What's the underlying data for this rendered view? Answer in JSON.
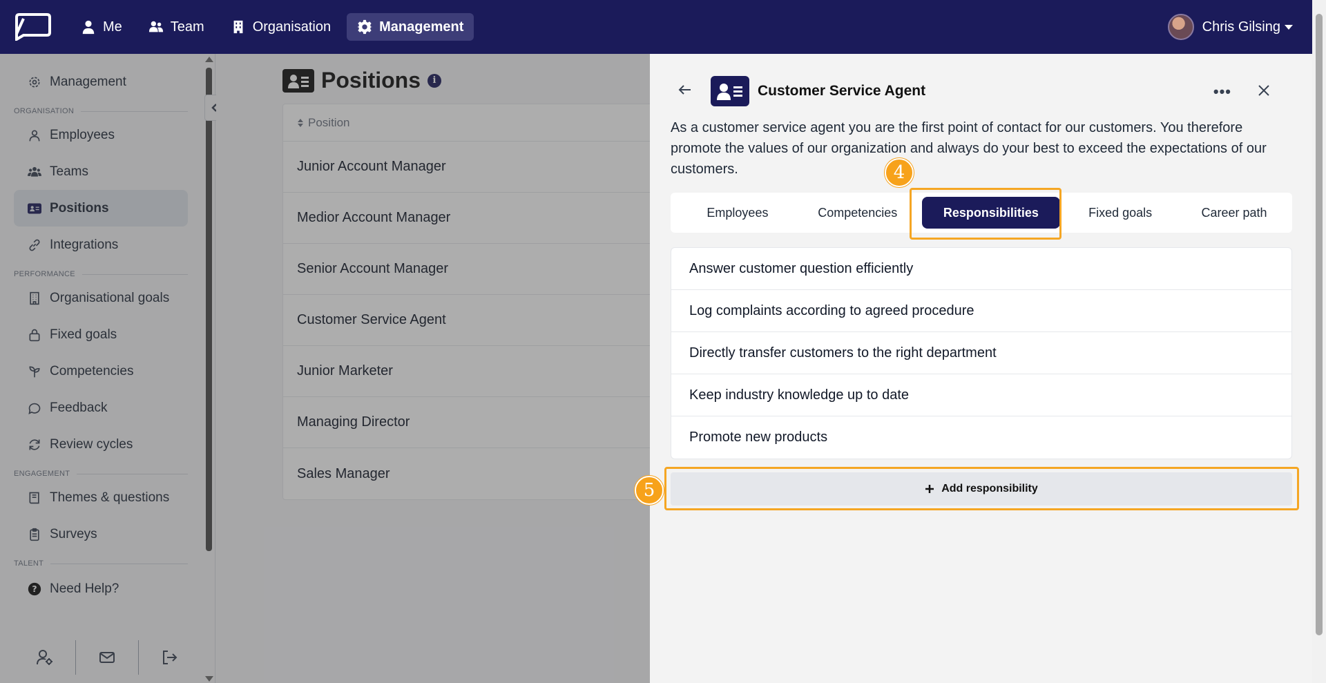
{
  "nav": {
    "items": [
      {
        "label": "Me",
        "icon": "user-icon"
      },
      {
        "label": "Team",
        "icon": "users-icon"
      },
      {
        "label": "Organisation",
        "icon": "building-icon"
      },
      {
        "label": "Management",
        "icon": "gear-icon"
      }
    ],
    "active": "Management",
    "user_name": "Chris Gilsing"
  },
  "sidebar": {
    "top_item": "Management",
    "sections": {
      "organisation": "ORGANISATION",
      "performance": "PERFORMANCE",
      "engagement": "ENGAGEMENT",
      "talent": "TALENT"
    },
    "organisation_items": [
      "Employees",
      "Teams",
      "Positions",
      "Integrations"
    ],
    "performance_items": [
      "Organisational goals",
      "Fixed goals",
      "Competencies",
      "Feedback",
      "Review cycles"
    ],
    "engagement_items": [
      "Themes & questions",
      "Surveys"
    ],
    "help": "Need Help?",
    "active": "Positions"
  },
  "main": {
    "title": "Positions",
    "info_glyph": "i",
    "column_header": "Position",
    "rows": [
      "Junior Account Manager",
      "Medior Account Manager",
      "Senior Account Manager",
      "Customer Service Agent",
      "Junior Marketer",
      "Managing Director",
      "Sales Manager"
    ]
  },
  "drawer": {
    "title": "Customer Service Agent",
    "description": "As a customer service agent you are the first point of contact for our customers. You therefore promote the values of our organization and always do your best to exceed the expectations of our customers.",
    "tabs": [
      "Employees",
      "Competencies",
      "Responsibilities",
      "Fixed goals",
      "Career path"
    ],
    "active_tab": "Responsibilities",
    "responsibilities": [
      "Answer customer question efficiently",
      "Log complaints according to agreed procedure",
      "Directly transfer customers to the right department",
      "Keep industry knowledge up to date",
      "Promote new products"
    ],
    "add_label": "Add responsibility"
  },
  "steps": {
    "four": "4",
    "five": "5"
  },
  "colors": {
    "brand": "#1b1b5a",
    "highlight": "#f5a623"
  }
}
